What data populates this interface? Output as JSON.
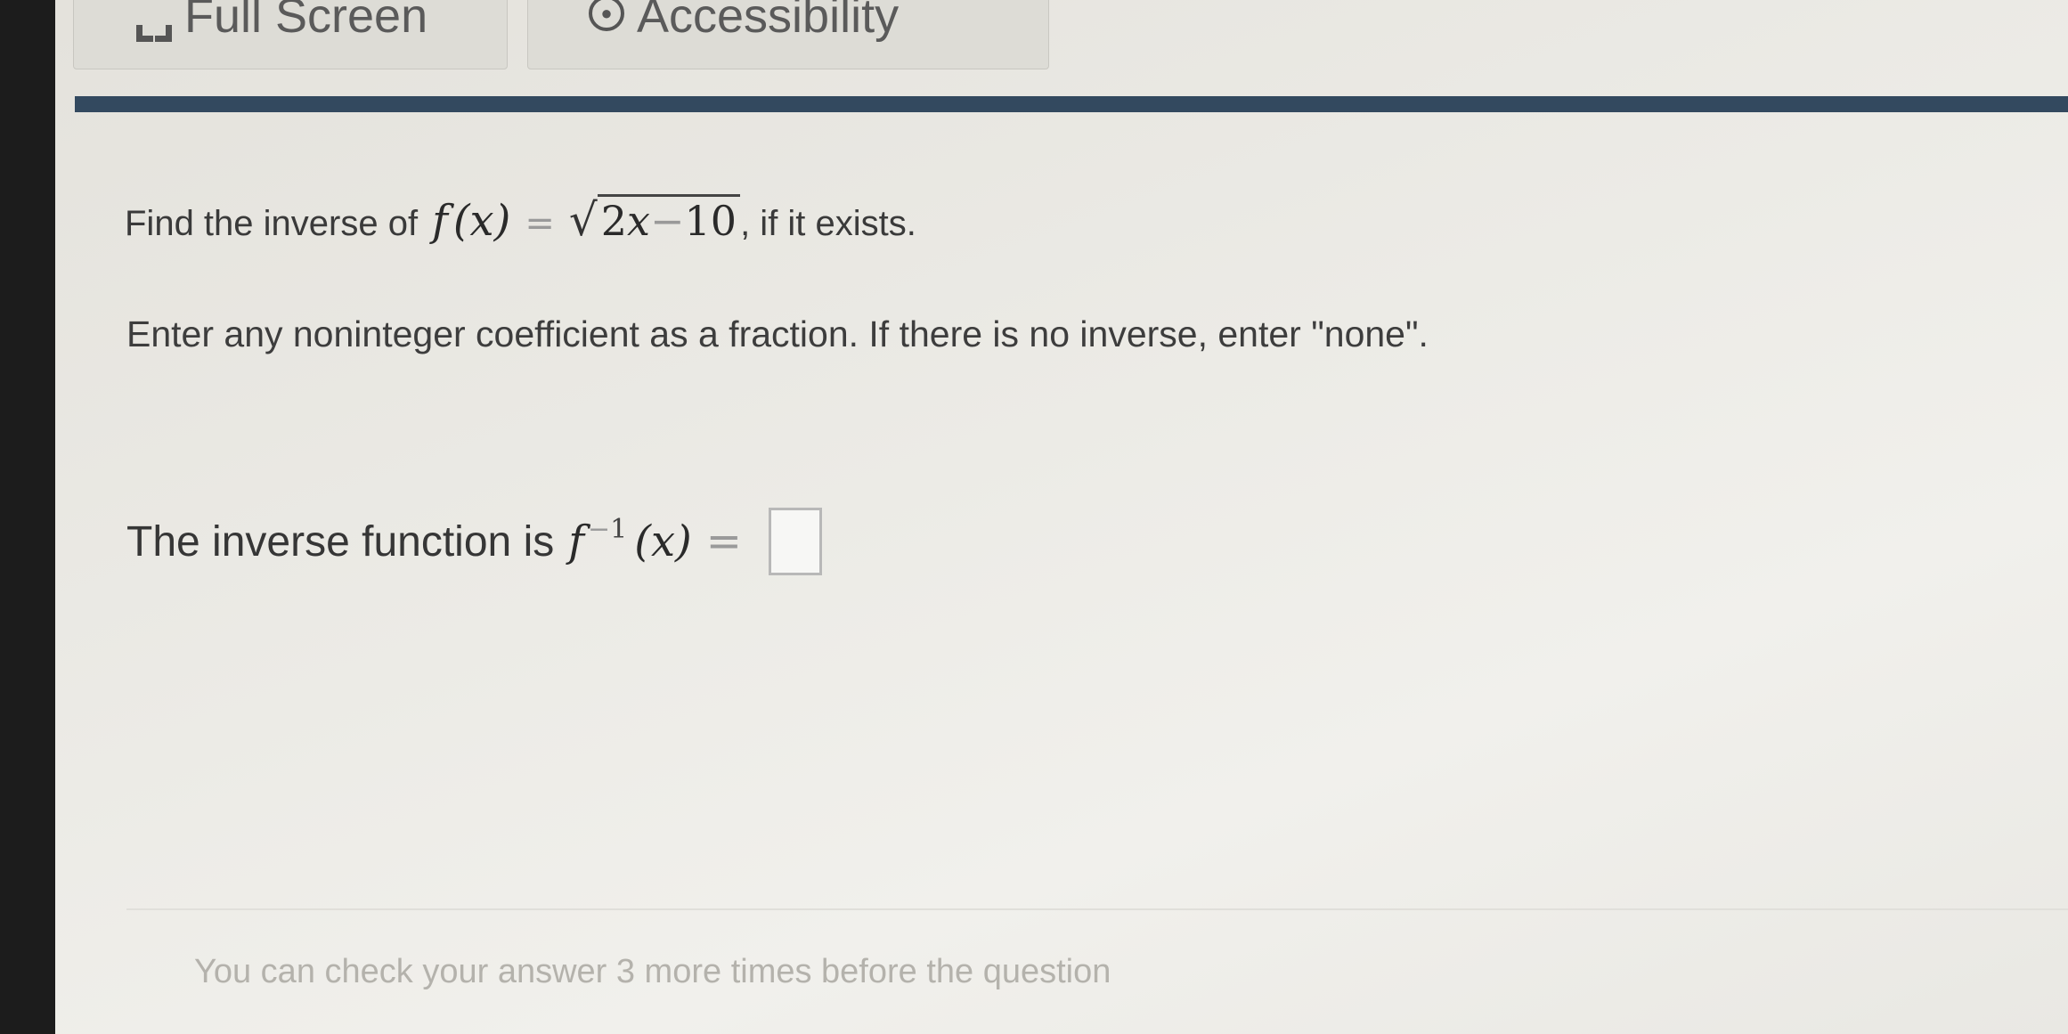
{
  "toolbar": {
    "fullscreen_label": "Full Screen",
    "accessibility_label": "Accessibility"
  },
  "question": {
    "prefix": "Find the inverse of",
    "function_name": "f",
    "function_arg": "(x)",
    "equals": "=",
    "radical": "√",
    "radicand_coef": "2",
    "radicand_var": "x",
    "radicand_minus": "−",
    "radicand_const": "10",
    "suffix": ", if it exists."
  },
  "instruction": "Enter any noninteger coefficient as a fraction. If there is no inverse, enter \"none\".",
  "answer": {
    "prefix": "The inverse function is",
    "function_name": "f",
    "superscript_minus": "−",
    "superscript_one": "1",
    "function_arg": "(x)",
    "equals": "=",
    "value": ""
  },
  "footer_note": "You can check your answer 3 more times before the question"
}
